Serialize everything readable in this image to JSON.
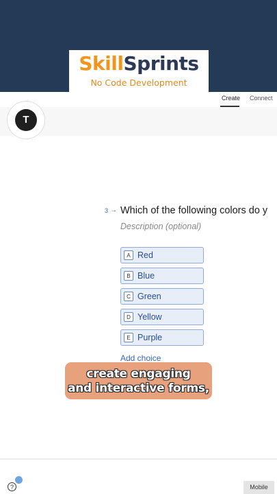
{
  "logo": {
    "word1": "Skill",
    "word2": "Sprints",
    "tagline": "No Code Development"
  },
  "tabs": {
    "create": "Create",
    "connect": "Connect"
  },
  "avatar": {
    "initial": "T"
  },
  "question": {
    "number": "3",
    "arrow": "→",
    "title": "Which of the following colors do y",
    "description_placeholder": "Description (optional)",
    "choices": [
      {
        "key": "A",
        "label": "Red"
      },
      {
        "key": "B",
        "label": "Blue"
      },
      {
        "key": "C",
        "label": "Green"
      },
      {
        "key": "D",
        "label": "Yellow"
      },
      {
        "key": "E",
        "label": "Purple"
      }
    ],
    "add_choice": "Add choice"
  },
  "caption": {
    "line1": "create engaging",
    "line2": "and interactive forms,"
  },
  "footer": {
    "help": "?",
    "mobile": "Mobile"
  },
  "colors": {
    "banner": "#243a56",
    "accent_orange": "#f0961e",
    "choice_bg": "#e7eef8",
    "caption_bg": "#e8a17d"
  }
}
